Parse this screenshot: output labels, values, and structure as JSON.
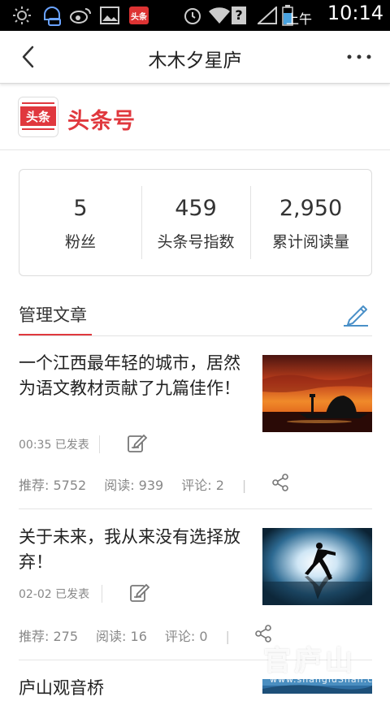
{
  "status_bar": {
    "ampm": "上午",
    "time": "10:14",
    "app_badge": "头条",
    "question_mark": "?",
    "icons": [
      "brightness-icon",
      "chat-icon",
      "weibo-icon",
      "image-icon",
      "toutiao-app-icon",
      "alarm-icon",
      "wifi-icon",
      "signal-icon",
      "battery-icon"
    ]
  },
  "navbar": {
    "title": "木木夕星庐",
    "back_icon": "chevron-left-icon",
    "more_icon": "more-dots-icon"
  },
  "brand": {
    "logo_text": "头条",
    "name": "头条号",
    "accent_color": "#e0383e"
  },
  "stats": [
    {
      "value": "5",
      "label": "粉丝"
    },
    {
      "value": "459",
      "label": "头条号指数"
    },
    {
      "value": "2,950",
      "label": "累计阅读量"
    }
  ],
  "section": {
    "title": "管理文章",
    "edit_icon": "compose-icon"
  },
  "articles": [
    {
      "title": "一个江西最年轻的城市，居然为语文教材贡献了九篇佳作！",
      "time": "00:35 已发表",
      "recommend": "推荐: 5752",
      "reads": "阅读: 939",
      "comments": "评论: 2",
      "image": "sunset-pagoda-image"
    },
    {
      "title": "关于未来，我从来没有选择放弃！",
      "time": "02-02 已发表",
      "recommend": "推荐: 275",
      "reads": "阅读: 16",
      "comments": "评论: 0",
      "image": "runner-silhouette-image"
    },
    {
      "title": "庐山观音桥",
      "image": "lushan-bridge-image"
    }
  ],
  "watermark": {
    "big": "官庐山",
    "small": "www.shangluShan.com"
  }
}
